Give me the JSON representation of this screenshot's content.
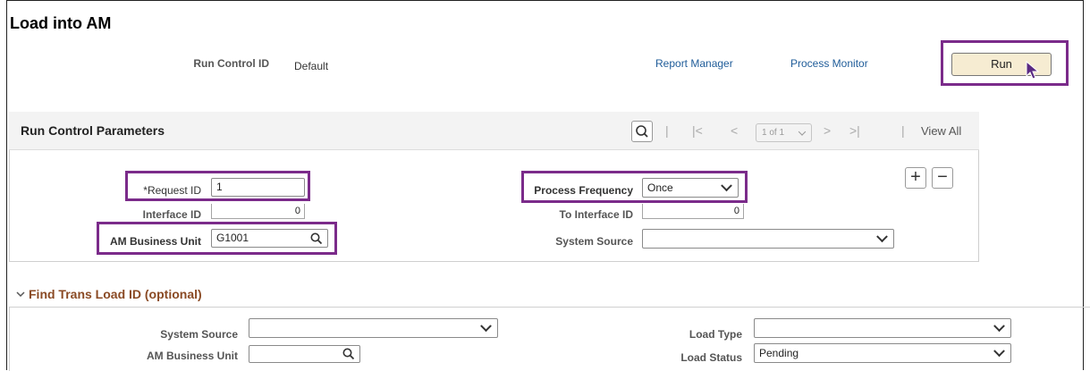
{
  "page": {
    "title": "Load into AM"
  },
  "header": {
    "run_control_label": "Run Control ID",
    "run_control_value": "Default",
    "report_manager": "Report Manager",
    "process_monitor": "Process Monitor",
    "run_label": "Run"
  },
  "params": {
    "title": "Run Control Parameters",
    "pager_value": "1 of 1",
    "separator": "|",
    "first_glyph": "|<",
    "prev_glyph": "<",
    "next_glyph": ">",
    "last_glyph": ">|",
    "view_all": "View All",
    "request_id_label": "*Request ID",
    "request_id_value": "1",
    "interface_id_label": "Interface ID",
    "interface_id_value": "0",
    "business_unit_label": "AM Business Unit",
    "business_unit_value": "G1001",
    "process_frequency_label": "Process Frequency",
    "process_frequency_value": "Once",
    "to_interface_label": "To Interface ID",
    "to_interface_value": "0",
    "system_source_label": "System Source",
    "system_source_value": "",
    "add_glyph": "+",
    "remove_glyph": "−"
  },
  "find": {
    "title": "Find Trans Load ID (optional)",
    "system_source_label": "System Source",
    "system_source_value": "",
    "business_unit_label": "AM Business Unit",
    "business_unit_value": "",
    "load_type_label": "Load Type",
    "load_type_value": "",
    "load_status_label": "Load Status",
    "load_status_value": "Pending"
  },
  "icons": {
    "search": "search-icon",
    "chevron": "chevron-down-icon",
    "collapse": "chevron-down-icon",
    "cursor": "mouse-pointer-icon"
  },
  "colors": {
    "highlight": "#7b2b8a",
    "link": "#1f5c99",
    "run_button": "#f6ecd2",
    "find_title": "#8a4a24"
  }
}
